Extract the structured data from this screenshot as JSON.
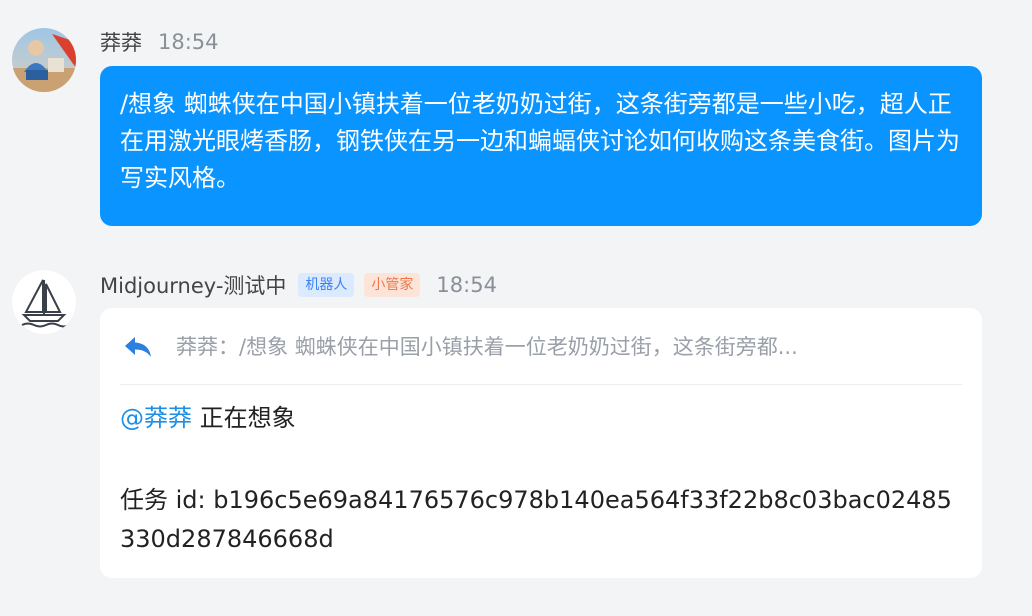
{
  "messages": [
    {
      "sender": "莽莽",
      "time": "18:54",
      "avatar_icon": "user-avatar-photo",
      "text": "/想象 蜘蛛侠在中国小镇扶着一位老奶奶过街，这条街旁都是一些小吃，超人正在用激光眼烤香肠，钢铁侠在另一边和蝙蝠侠讨论如何收购这条美食街。图片为写实风格。"
    },
    {
      "sender": "Midjourney-测试中",
      "time": "18:54",
      "avatar_icon": "sailboat-logo-icon",
      "tags": [
        "机器人",
        "小管家"
      ],
      "quote_icon": "reply-arrow-icon",
      "quote_text": "莽莽：/想象 蜘蛛侠在中国小镇扶着一位老奶奶过街，这条街旁都...",
      "mention": "@莽莽",
      "status": "正在想象",
      "task_id": "任务 id: b196c5e69a84176576c978b140ea564f33f22b8c03bac02485330d287846668d"
    }
  ],
  "colors": {
    "background": "#f3f4f6",
    "user_bubble": "#0a94ff",
    "mention": "#1d8fe6",
    "bot_tag_bg": "#dbeafe",
    "bot_tag_text": "#3b82f6",
    "admin_tag_bg": "#fde4d8",
    "admin_tag_text": "#f0764a"
  }
}
